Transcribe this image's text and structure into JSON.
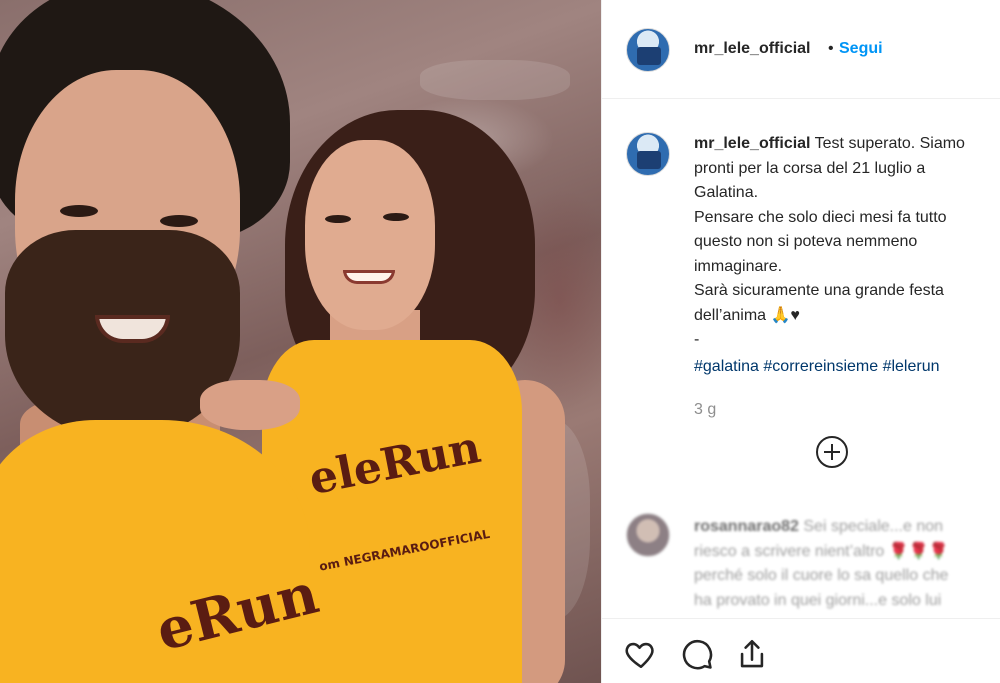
{
  "photo": {
    "alt_people": "two people in yellow shirts",
    "man_shirt_text": "eRun",
    "woman_shirt_text": "eleRun",
    "woman_shirt_subtext": "om NEGRAMAROOFFICIAL",
    "shirt_color": "#f8b321"
  },
  "header": {
    "username": "mr_lele_official",
    "separator": "•",
    "follow_label": "Segui",
    "follow_color": "#0095f6"
  },
  "caption": {
    "username": "mr_lele_official",
    "text": " Test superato. Siamo\npronti per la corsa del 21 luglio a\nGalatina.\nPensare che solo dieci mesi fa tutto\nquesto non si poteva nemmeno\nimmaginare.\nSarà sicuramente una grande festa\ndell’anima 🙏♥\n-",
    "hashtags": [
      "#galatina",
      "#correreinsieme",
      "#lelerun"
    ],
    "time": "3 g"
  },
  "comment": {
    "username": "rosannarao82",
    "text": " Sei speciale...e non\nriesco a scrivere nient’altro 🌹🌹🌹\nperché solo il cuore lo sa quello che\nha provato in quei giorni...e solo lui"
  },
  "actions": {
    "icons": [
      "heart-icon",
      "comment-icon",
      "share-icon"
    ]
  }
}
